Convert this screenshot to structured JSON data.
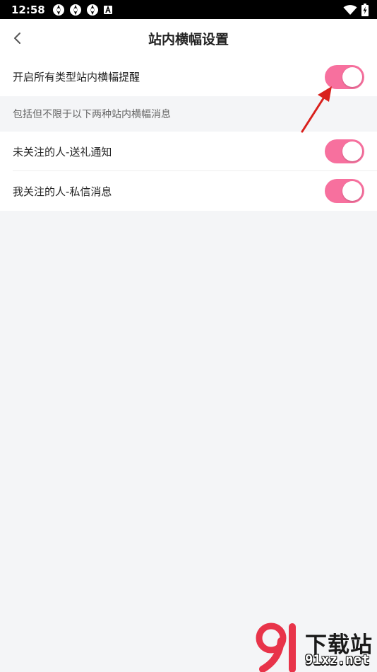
{
  "status_bar": {
    "time": "12:58",
    "icons": [
      "app-notification-icon",
      "app-notification-icon",
      "app-notification-icon",
      "a-badge-icon",
      "wifi-icon",
      "battery-charging-icon"
    ]
  },
  "header": {
    "title": "站内横幅设置",
    "back_icon": "chevron-left-icon"
  },
  "settings": {
    "main": {
      "label": "开启所有类型站内横幅提醒",
      "enabled": true
    },
    "section_hint": "包括但不限于以下两种站内横幅消息",
    "items": [
      {
        "label": "未关注的人-送礼通知",
        "enabled": true
      },
      {
        "label": "我关注的人-私信消息",
        "enabled": true
      }
    ]
  },
  "watermark": {
    "title": "下载站",
    "url": "91xz.net"
  },
  "colors": {
    "toggle_on": "#f7709e",
    "annotation": "#d9201c",
    "page_bg": "#f4f5f7",
    "status_bar": "#000000"
  }
}
